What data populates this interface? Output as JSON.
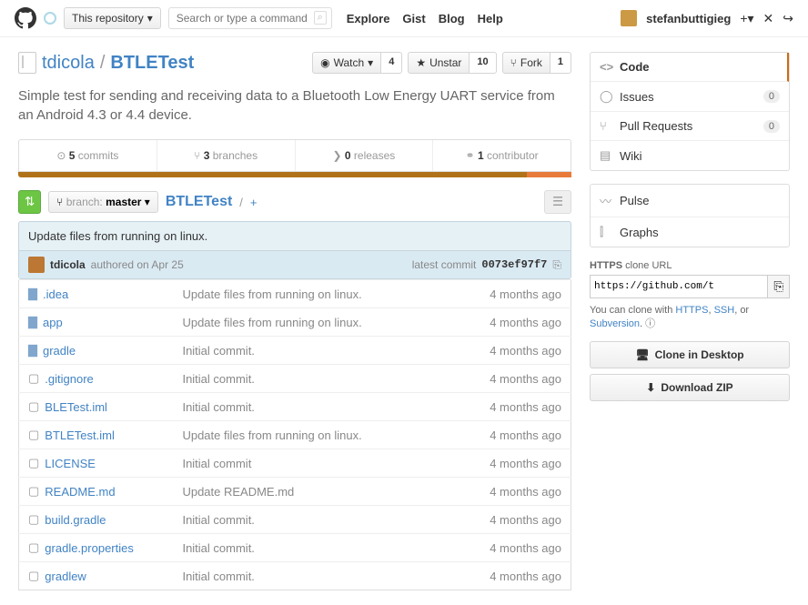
{
  "top": {
    "scope": "This repository",
    "search_placeholder": "Search or type a command",
    "nav": [
      "Explore",
      "Gist",
      "Blog",
      "Help"
    ],
    "user": "stefanbuttigieg",
    "plus": "+"
  },
  "repo": {
    "owner": "tdicola",
    "name": "BTLETest",
    "description": "Simple test for sending and receiving data to a Bluetooth Low Energy UART service from an Android 4.3 or 4.4 device."
  },
  "actions": {
    "watch": "Watch",
    "watch_count": "4",
    "star": "Unstar",
    "star_count": "10",
    "fork": "Fork",
    "fork_count": "1"
  },
  "stats": {
    "commits_n": "5",
    "commits_l": "commits",
    "branches_n": "3",
    "branches_l": "branches",
    "releases_n": "0",
    "releases_l": "releases",
    "contrib_n": "1",
    "contrib_l": "contributor"
  },
  "filenav": {
    "branch_label": "branch:",
    "branch_value": "master",
    "crumb_root": "BTLETest",
    "crumb_sep": "/",
    "plus": "+"
  },
  "commit": {
    "message": "Update files from running on linux.",
    "author": "tdicola",
    "authored": "authored on Apr 25",
    "latest_label": "latest commit",
    "sha": "0073ef97f7"
  },
  "files": [
    {
      "type": "folder",
      "name": ".idea",
      "msg": "Update files from running on linux.",
      "age": "4 months ago"
    },
    {
      "type": "folder",
      "name": "app",
      "msg": "Update files from running on linux.",
      "age": "4 months ago"
    },
    {
      "type": "folder",
      "name": "gradle",
      "msg": "Initial commit.",
      "age": "4 months ago"
    },
    {
      "type": "file",
      "name": ".gitignore",
      "msg": "Initial commit.",
      "age": "4 months ago"
    },
    {
      "type": "file",
      "name": "BLETest.iml",
      "msg": "Initial commit.",
      "age": "4 months ago"
    },
    {
      "type": "file",
      "name": "BTLETest.iml",
      "msg": "Update files from running on linux.",
      "age": "4 months ago"
    },
    {
      "type": "file",
      "name": "LICENSE",
      "msg": "Initial commit",
      "age": "4 months ago"
    },
    {
      "type": "file",
      "name": "README.md",
      "msg": "Update README.md",
      "age": "4 months ago"
    },
    {
      "type": "file",
      "name": "build.gradle",
      "msg": "Initial commit.",
      "age": "4 months ago"
    },
    {
      "type": "file",
      "name": "gradle.properties",
      "msg": "Initial commit.",
      "age": "4 months ago"
    },
    {
      "type": "file",
      "name": "gradlew",
      "msg": "Initial commit.",
      "age": "4 months ago"
    }
  ],
  "sidebar": {
    "code": "Code",
    "issues": "Issues",
    "issues_n": "0",
    "prs": "Pull Requests",
    "prs_n": "0",
    "wiki": "Wiki",
    "pulse": "Pulse",
    "graphs": "Graphs"
  },
  "clone": {
    "proto": "HTTPS",
    "label": "clone URL",
    "url": "https://github.com/t",
    "info_pre": "You can clone with ",
    "https": "HTTPS",
    "ssh": "SSH",
    "svn": "Subversion",
    "or": ", or ",
    "desktop": "Clone in Desktop",
    "zip": "Download ZIP"
  }
}
